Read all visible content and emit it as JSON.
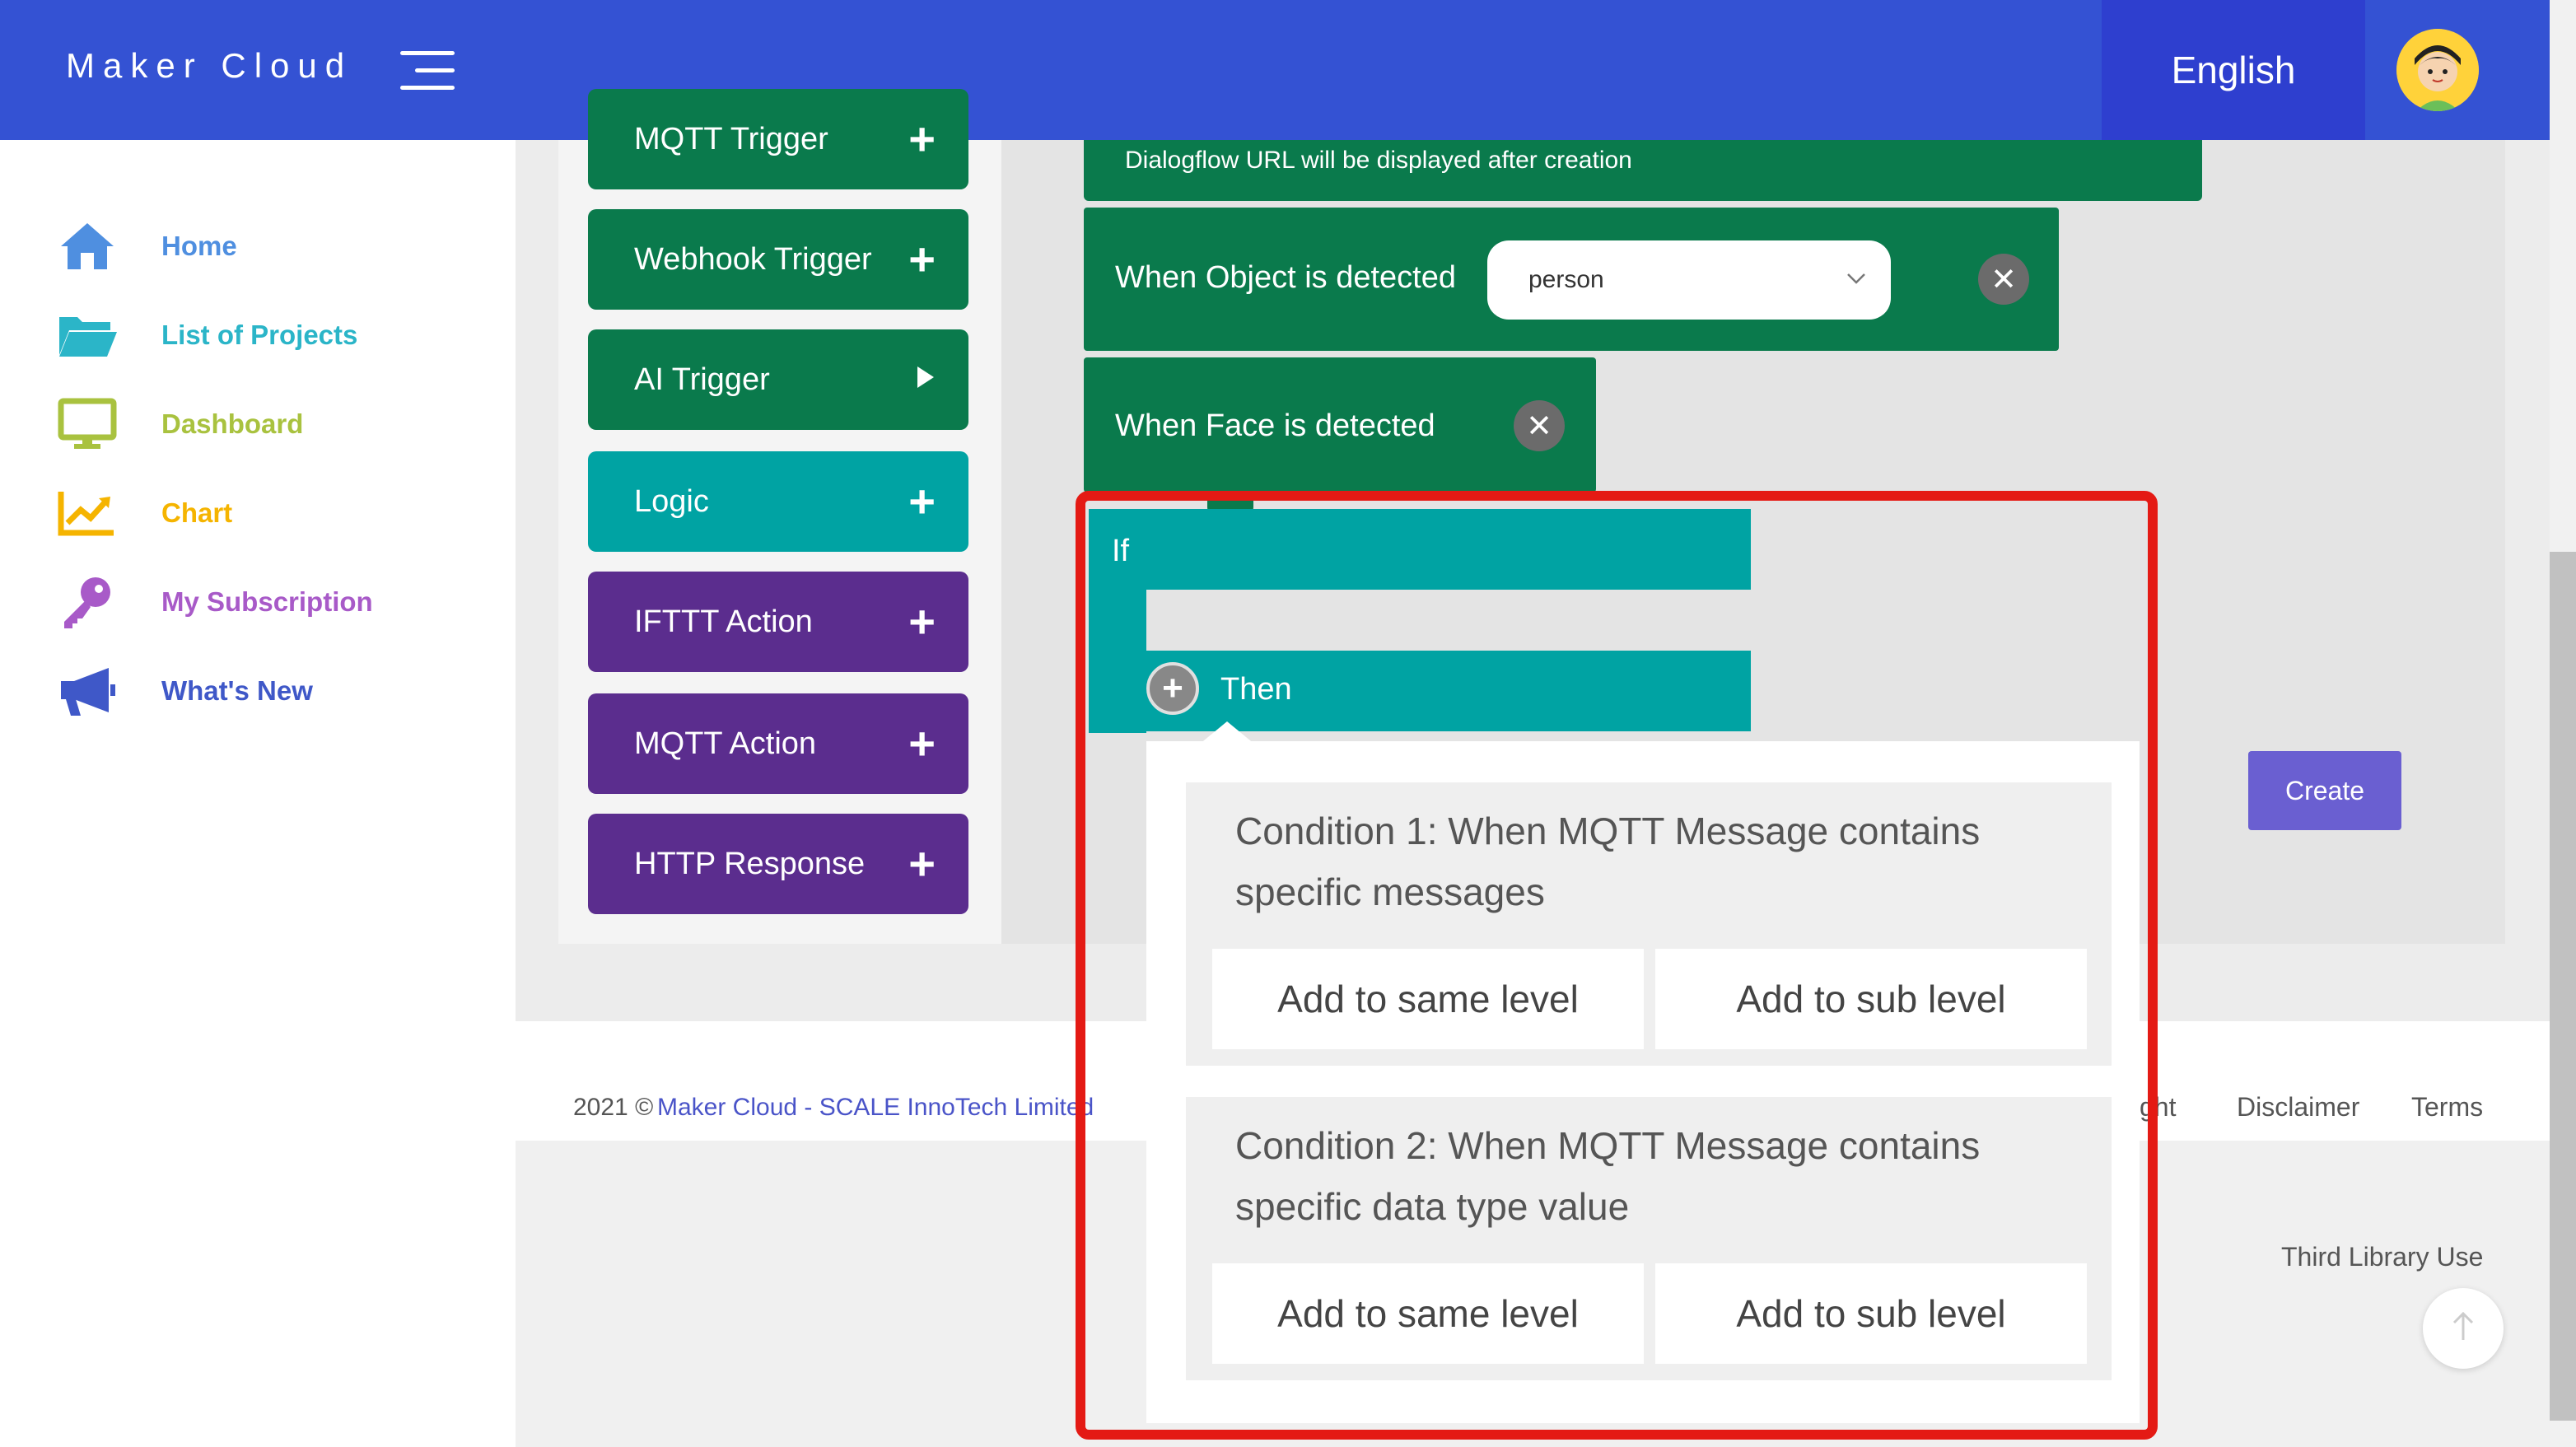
{
  "header": {
    "brand": "Maker Cloud",
    "menu_icon": "hamburger-icon",
    "language": "English",
    "avatar_icon": "user-avatar-icon",
    "color": "#3452d3"
  },
  "sidebar": {
    "items": [
      {
        "label": "Home",
        "icon": "home-icon",
        "color": "#4f8fe0"
      },
      {
        "label": "List of Projects",
        "icon": "folder-icon",
        "color": "#2bb5c8"
      },
      {
        "label": "Dashboard",
        "icon": "monitor-icon",
        "color": "#a9c23f"
      },
      {
        "label": "Chart",
        "icon": "chart-icon",
        "color": "#f5b400"
      },
      {
        "label": "My Subscription",
        "icon": "key-icon",
        "color": "#a85ac8"
      },
      {
        "label": "What's New",
        "icon": "megaphone-icon",
        "color": "#3f58c8"
      }
    ]
  },
  "palette": {
    "items": [
      {
        "label": "MQTT Trigger",
        "icon": "plus-icon",
        "color": "#0a7a4c"
      },
      {
        "label": "Webhook Trigger",
        "icon": "plus-icon",
        "color": "#0a7a4c"
      },
      {
        "label": "AI Trigger",
        "icon": "triangle-right-icon",
        "color": "#0a7a4c"
      },
      {
        "label": "Logic",
        "icon": "plus-icon",
        "color": "#00a3a3"
      },
      {
        "label": "IFTTT Action",
        "icon": "plus-icon",
        "color": "#5b2d8e"
      },
      {
        "label": "MQTT Action",
        "icon": "plus-icon",
        "color": "#5b2d8e"
      },
      {
        "label": "HTTP Response",
        "icon": "plus-icon",
        "color": "#5b2d8e"
      }
    ]
  },
  "canvas": {
    "dialogflow_note": "Dialogflow URL will be displayed after creation",
    "object_block": {
      "label": "When Object is detected",
      "select_value": "person"
    },
    "face_block": {
      "label": "When Face is detected"
    },
    "if_block": {
      "if_label": "If",
      "then_label": "Then"
    },
    "create_button": "Create"
  },
  "popup": {
    "conditions": [
      {
        "title": "Condition 1: When MQTT Message contains specific messages",
        "same_level": "Add to same level",
        "sub_level": "Add to sub level"
      },
      {
        "title": "Condition 2: When MQTT Message contains specific data type value",
        "same_level": "Add to same level",
        "sub_level": "Add to sub level"
      }
    ],
    "highlight_color": "#e41a14"
  },
  "footer": {
    "copyright_prefix": "2021 ©",
    "copyright_link": "Maker Cloud - SCALE InnoTech Limited",
    "links": [
      "ght",
      "Disclaimer",
      "Terms"
    ],
    "third_library": "Third Library Use",
    "scroll_top_icon": "arrow-up-icon"
  }
}
